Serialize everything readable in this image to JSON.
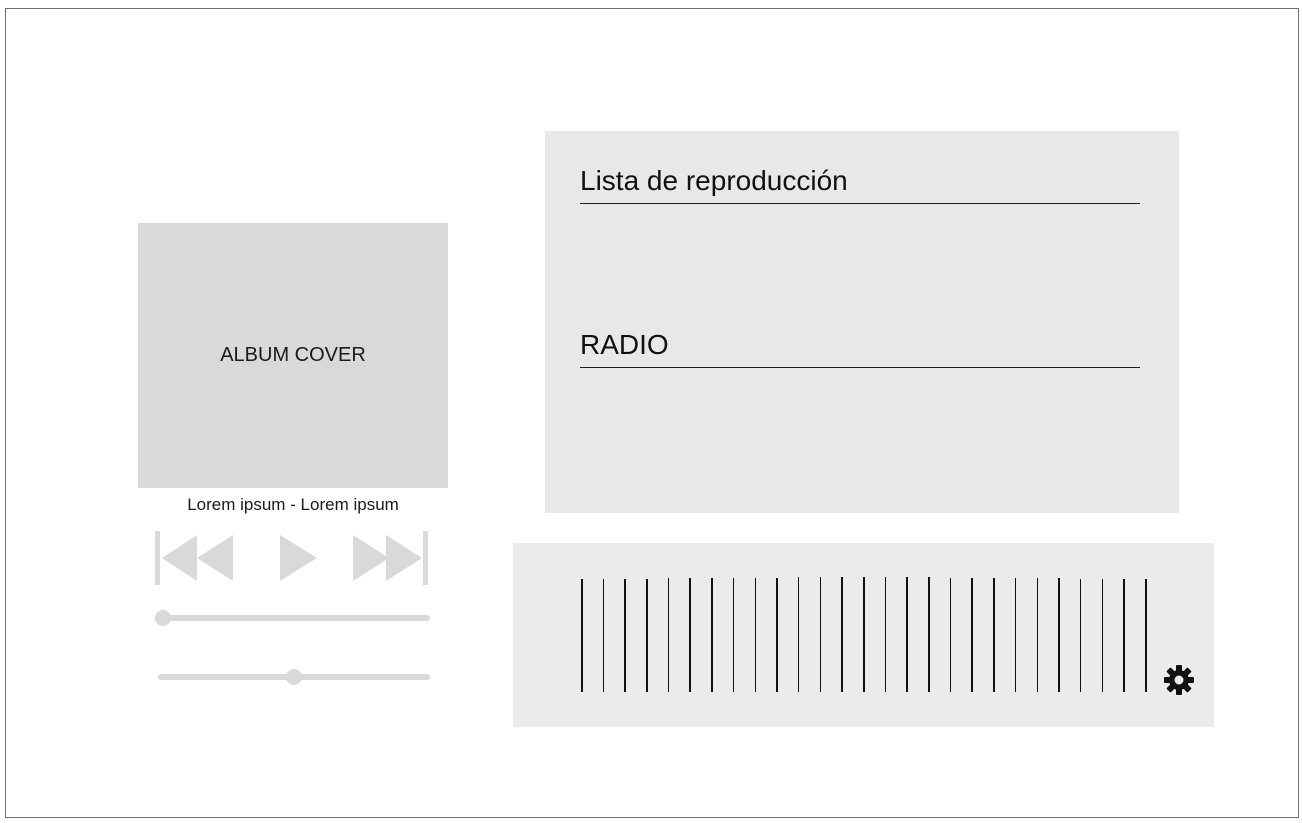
{
  "album": {
    "cover_label": "ALBUM COVER"
  },
  "track": {
    "title": "Lorem ipsum - Lorem ipsum"
  },
  "player": {
    "progress_level": 0.02,
    "volume_level": 0.5
  },
  "menu": {
    "playlist_label": "Lista de reproducción",
    "radio_label": "RADIO"
  },
  "equalizer": {
    "bar_count": 27,
    "icon": "gear-icon"
  },
  "colors": {
    "control_gray": "#d9d9d9",
    "panel_gray": "#e8e8e8",
    "line_dark": "#111111"
  }
}
